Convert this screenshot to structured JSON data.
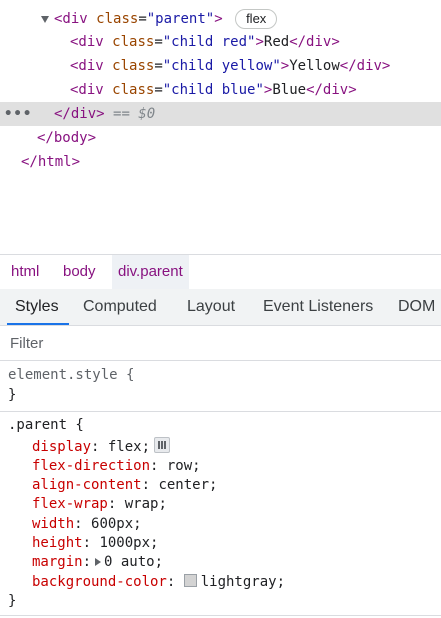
{
  "elements": {
    "lines": [
      {
        "prefix": "<div class=\"parent\">",
        "parts": {
          "tag_open": "<div",
          "attr": "class",
          "eq": "=",
          "val": "\"parent\"",
          "close": ">"
        },
        "badge": "flex"
      },
      {
        "c1": "<div",
        "a": "class",
        "v": "\"child red\"",
        "c2": ">",
        "t": "Red",
        "c3": "</div>"
      },
      {
        "c1": "<div",
        "a": "class",
        "v": "\"child yellow\"",
        "c2": ">",
        "t": "Yellow",
        "c3": "</div>"
      },
      {
        "c1": "<div",
        "a": "class",
        "v": "\"child blue\"",
        "c2": ">",
        "t": "Blue",
        "c3": "</div>"
      }
    ],
    "selected_close": "</div>",
    "selected_marker": "== $0",
    "body_close": "</body>",
    "html_close": "</html>",
    "ellipsis": "•••"
  },
  "breadcrumbs": [
    "html",
    "body",
    "div.parent"
  ],
  "tabs": [
    "Styles",
    "Computed",
    "Layout",
    "Event Listeners",
    "DOM"
  ],
  "filter": {
    "placeholder": "Filter",
    "value": ""
  },
  "styles": {
    "element_style": {
      "selector": "element.style {",
      "close": "}"
    },
    "parent_rule": {
      "selector": ".parent {",
      "close": "}",
      "props": [
        {
          "name": "display",
          "value": "flex"
        },
        {
          "name": "flex-direction",
          "value": "row"
        },
        {
          "name": "align-content",
          "value": "center"
        },
        {
          "name": "flex-wrap",
          "value": "wrap"
        },
        {
          "name": "width",
          "value": "600px"
        },
        {
          "name": "height",
          "value": "1000px"
        },
        {
          "name": "margin",
          "value": "0 auto"
        },
        {
          "name": "background-color",
          "value": "lightgray"
        }
      ]
    }
  },
  "colors": {
    "tag": "#881280",
    "attr": "#994500",
    "attr_value": "#1a1aa6",
    "prop": "#c80000",
    "accent": "#1a73e8",
    "swatch": "#d3d3d3"
  }
}
